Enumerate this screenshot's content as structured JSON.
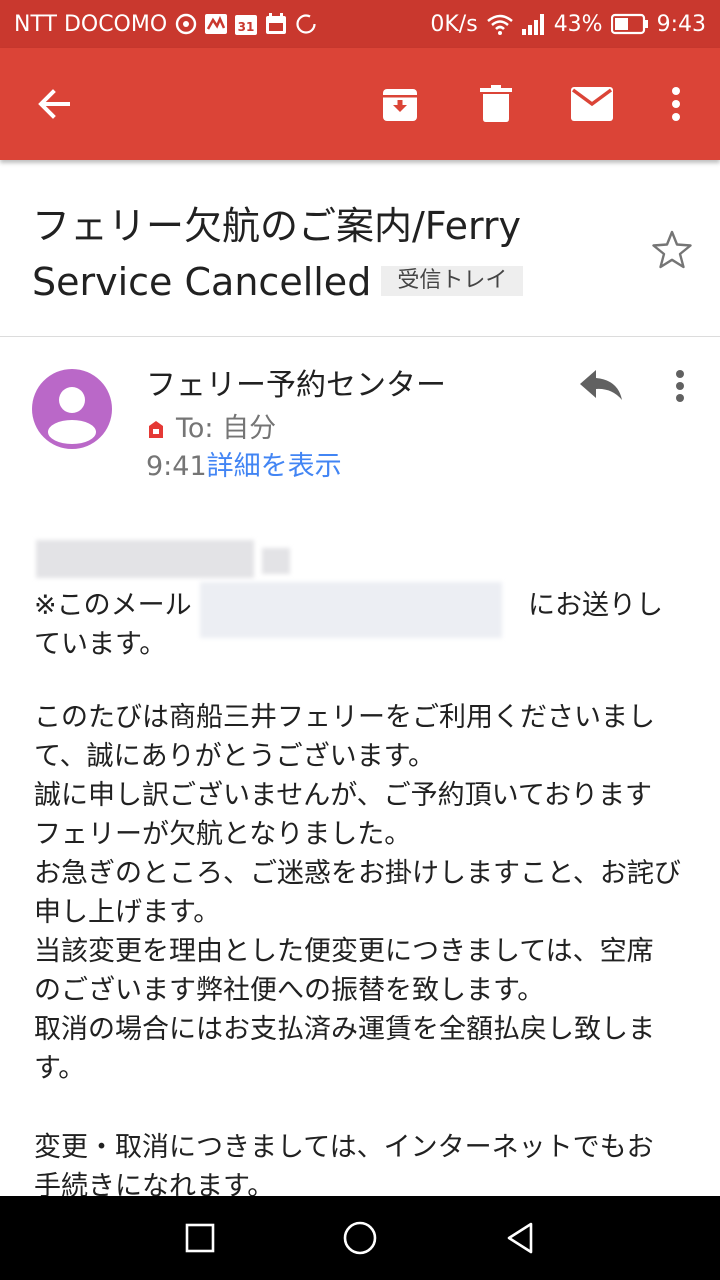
{
  "status_bar": {
    "carrier": "NTT DOCOMO",
    "net_speed": "0K/s",
    "battery": "43%",
    "time": "9:43"
  },
  "toolbar": {
    "back_icon": "arrow-left",
    "archive_icon": "archive",
    "delete_icon": "trash",
    "mark_unread_icon": "mail",
    "more_icon": "dots-vertical",
    "color": "#db4437"
  },
  "email": {
    "subject_line1": "フェリー欠航のご案内/Ferry",
    "subject_line2": "Service Cancelled",
    "label": "受信トレイ",
    "sender": "フェリー予約センター",
    "to": "To: 自分",
    "time": "9:41",
    "details_link": "詳細を表示",
    "avatar_color": "#ba68c8",
    "note_start": "※このメール",
    "note_end": "にお送りし",
    "note_line2": "ています。",
    "body_paragraph1": "このたびは商船三井フェリーをご利用くださいまし\nて、誠にありがとうございます。\n誠に申し訳ございませんが、ご予約頂いております\nフェリーが欠航となりました。\nお急ぎのところ、ご迷惑をお掛けしますこと、お詫び\n申し上げます。\n当該変更を理由とした便変更につきましては、空席\nのございます弊社便への振替を致します。\n取消の場合にはお支払済み運賃を全額払戻し致しま\nす。",
    "body_paragraph2": "変更・取消につきましては、インターネットでもお\n手続きになれます。"
  }
}
